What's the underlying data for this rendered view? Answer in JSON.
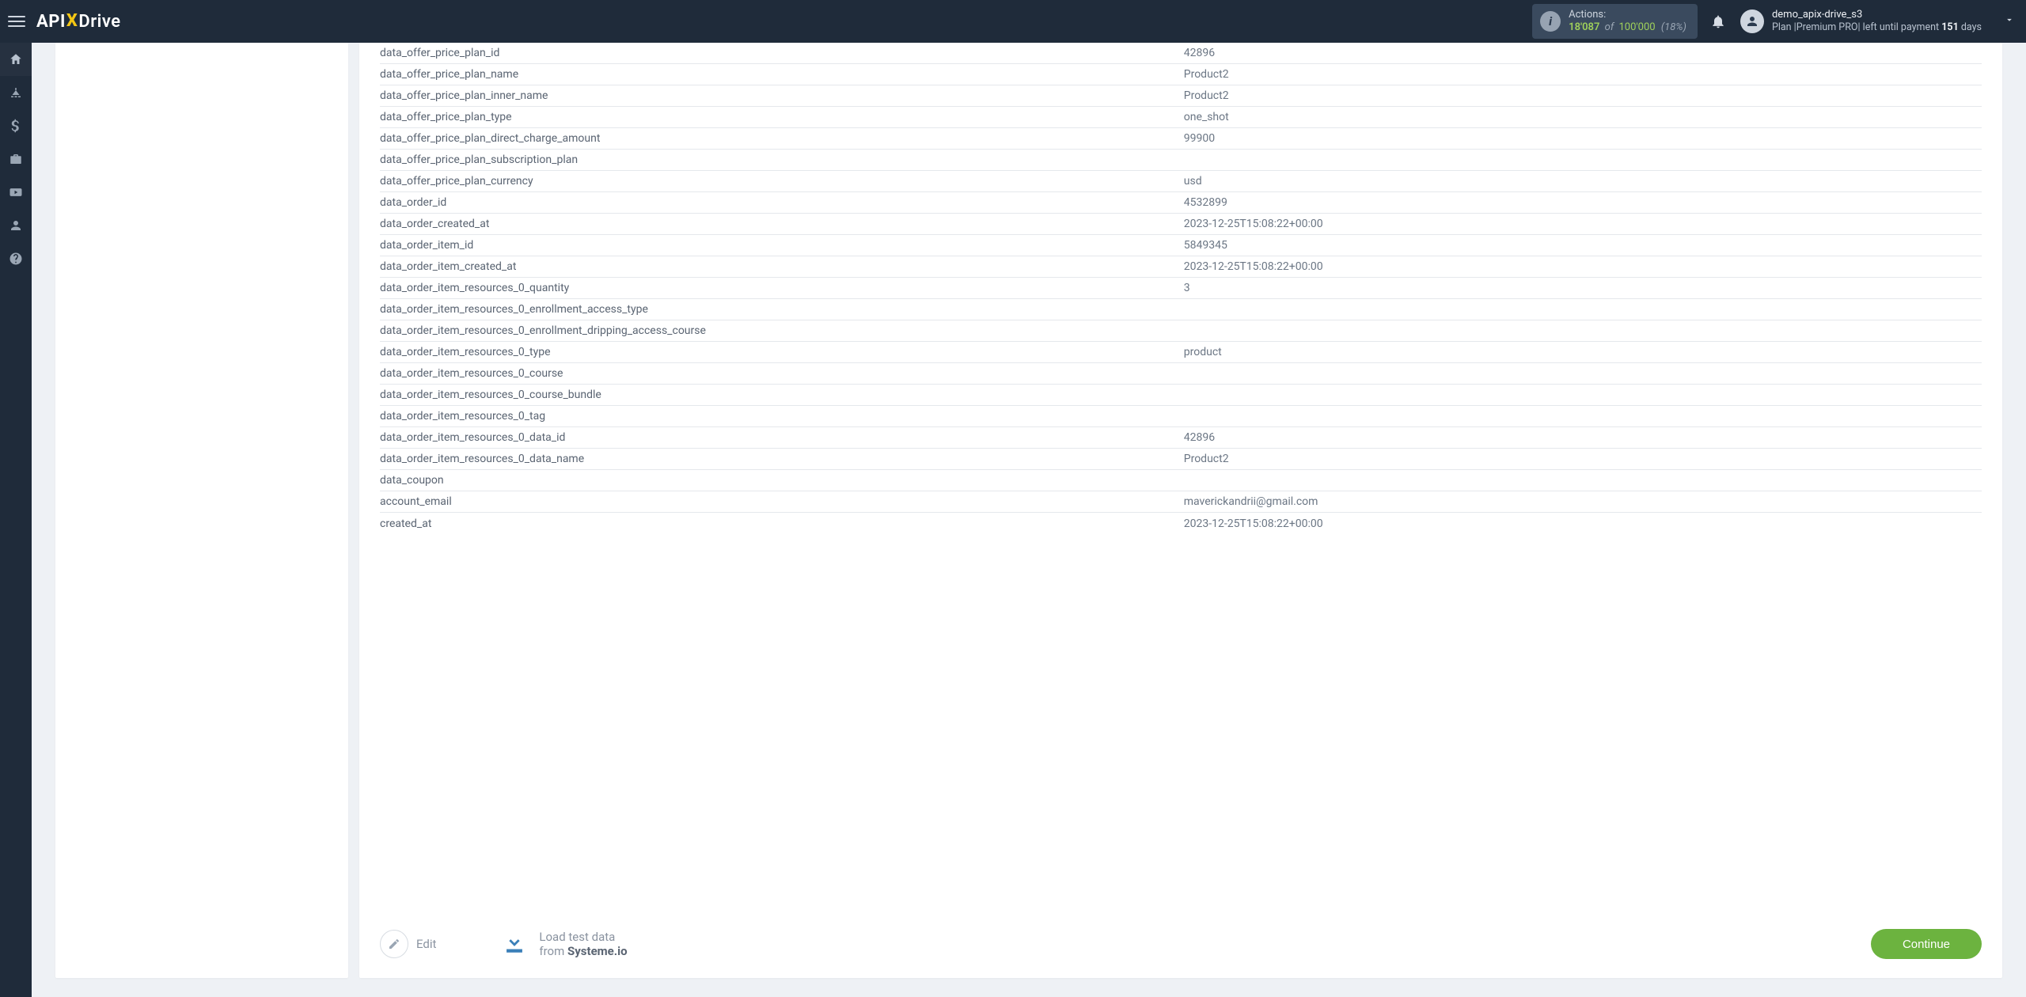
{
  "header": {
    "logo_api": "API",
    "logo_x": "X",
    "logo_drive": "Drive",
    "actions_label": "Actions:",
    "actions_used": "18'087",
    "actions_of": "of",
    "actions_total": "100'000",
    "actions_pct": "(18%)",
    "username": "demo_apix-drive_s3",
    "plan_prefix": "Plan |",
    "plan_name": "Premium PRO",
    "plan_mid": "| left until payment ",
    "plan_days": "151",
    "plan_suffix": " days"
  },
  "rows": [
    {
      "k": "data_offer_price_plan_id",
      "v": "42896"
    },
    {
      "k": "data_offer_price_plan_name",
      "v": "Product2"
    },
    {
      "k": "data_offer_price_plan_inner_name",
      "v": "Product2"
    },
    {
      "k": "data_offer_price_plan_type",
      "v": "one_shot"
    },
    {
      "k": "data_offer_price_plan_direct_charge_amount",
      "v": "99900"
    },
    {
      "k": "data_offer_price_plan_subscription_plan",
      "v": ""
    },
    {
      "k": "data_offer_price_plan_currency",
      "v": "usd"
    },
    {
      "k": "data_order_id",
      "v": "4532899"
    },
    {
      "k": "data_order_created_at",
      "v": "2023-12-25T15:08:22+00:00"
    },
    {
      "k": "data_order_item_id",
      "v": "5849345"
    },
    {
      "k": "data_order_item_created_at",
      "v": "2023-12-25T15:08:22+00:00"
    },
    {
      "k": "data_order_item_resources_0_quantity",
      "v": "3"
    },
    {
      "k": "data_order_item_resources_0_enrollment_access_type",
      "v": ""
    },
    {
      "k": "data_order_item_resources_0_enrollment_dripping_access_course",
      "v": ""
    },
    {
      "k": "data_order_item_resources_0_type",
      "v": "product"
    },
    {
      "k": "data_order_item_resources_0_course",
      "v": ""
    },
    {
      "k": "data_order_item_resources_0_course_bundle",
      "v": ""
    },
    {
      "k": "data_order_item_resources_0_tag",
      "v": ""
    },
    {
      "k": "data_order_item_resources_0_data_id",
      "v": "42896"
    },
    {
      "k": "data_order_item_resources_0_data_name",
      "v": "Product2"
    },
    {
      "k": "data_coupon",
      "v": ""
    },
    {
      "k": "account_email",
      "v": "maverickandrii@gmail.com"
    },
    {
      "k": "created_at",
      "v": "2023-12-25T15:08:22+00:00"
    }
  ],
  "footer": {
    "edit": "Edit",
    "load_l1": "Load test data",
    "load_from": "from ",
    "load_src": "Systeme.io",
    "continue": "Continue"
  }
}
